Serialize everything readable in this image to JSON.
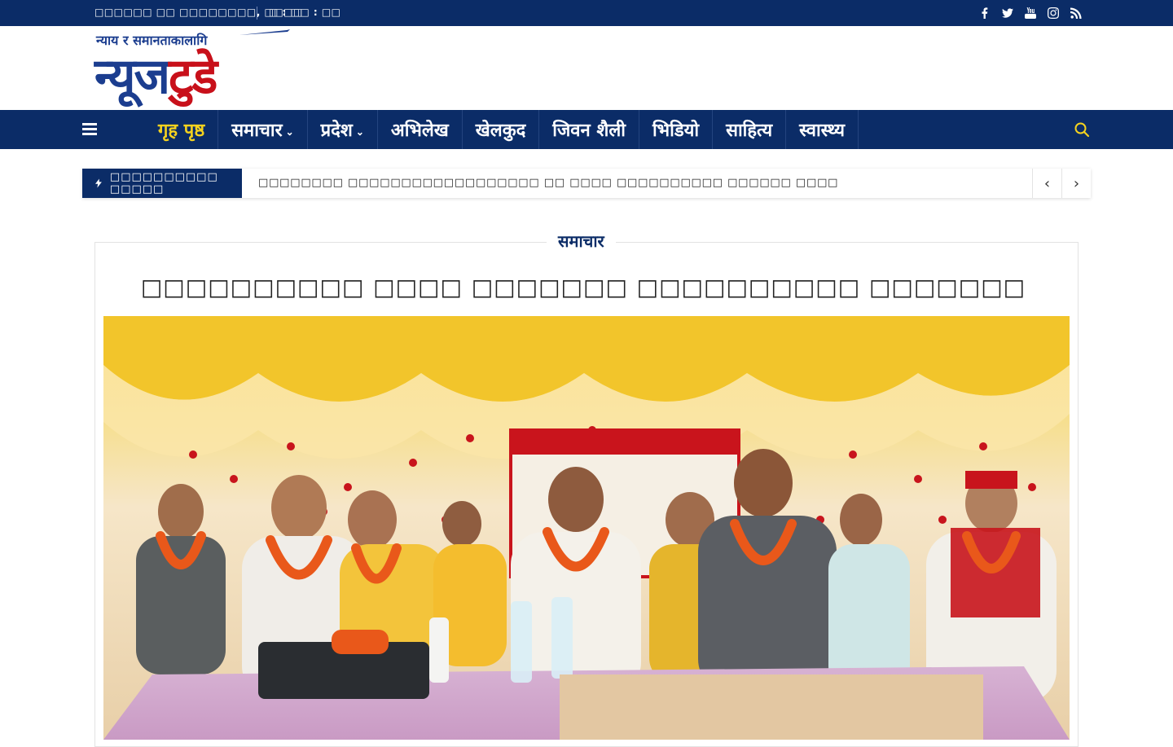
{
  "topbar": {
    "date": "□□□□□□ □□ □□□□□□□□, □□□□",
    "time": "□ : □□ : □□",
    "social": [
      "facebook-icon",
      "twitter-icon",
      "youtube-icon",
      "instagram-icon",
      "rss-icon"
    ]
  },
  "logo": {
    "tagline": "न्याय र समानताकालागि",
    "name_part1": "न्यूज",
    "name_part2": "टुडे"
  },
  "nav": {
    "items": [
      {
        "label": "गृह पृष्ठ",
        "active": true,
        "dropdown": false
      },
      {
        "label": "समाचार",
        "active": false,
        "dropdown": true
      },
      {
        "label": "प्रदेश",
        "active": false,
        "dropdown": true
      },
      {
        "label": "अभिलेख",
        "active": false,
        "dropdown": false
      },
      {
        "label": "खेलकुद",
        "active": false,
        "dropdown": false
      },
      {
        "label": "जिवन शैली",
        "active": false,
        "dropdown": false
      },
      {
        "label": "भिडियो",
        "active": false,
        "dropdown": false
      },
      {
        "label": "साहित्य",
        "active": false,
        "dropdown": false
      },
      {
        "label": "स्वास्थ्य",
        "active": false,
        "dropdown": false
      }
    ],
    "chevron": "⌄"
  },
  "ticker": {
    "label": "□□□□□□□□□□ □□□□□",
    "headline": "□□□□□□□□ □□□□□□□□□□□□□□□□□□ □□ □□□□ □□□□□□□□□□ □□□□□□ □□□□",
    "prev": "‹",
    "next": "›"
  },
  "article": {
    "category": "समाचार",
    "headline": "□□□□□□□□□□ □□□□ □□□□□□□ □□□□□□□□□□ □□□□□□□"
  },
  "colors": {
    "navy": "#0b2c67",
    "accent_yellow": "#f4d21f",
    "logo_red": "#c8101a"
  }
}
